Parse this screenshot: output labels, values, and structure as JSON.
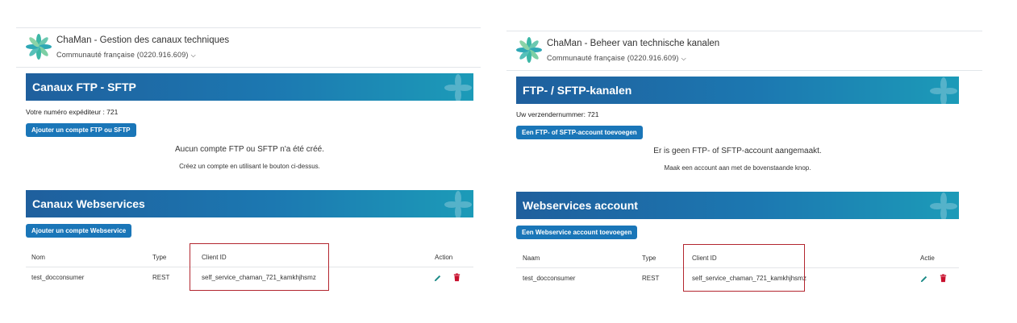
{
  "colors": {
    "banner_start": "#1f5f9d",
    "banner_end": "#1c9bb8",
    "button": "#1a76b8",
    "edit_icon": "#1a8a86",
    "delete_icon": "#c8102e",
    "highlight_box": "#b3262f"
  },
  "fr": {
    "header": {
      "app_title": "ChaMan - Gestion des canaux techniques",
      "org": "Communauté française (0220.916.609)"
    },
    "ftp": {
      "title": "Canaux FTP - SFTP",
      "sender": "Votre numéro expéditeur : 721",
      "add_button": "Ajouter un compte FTP ou SFTP",
      "empty_message": "Aucun compte FTP ou SFTP n'a été créé.",
      "empty_hint": "Créez un compte en utilisant le bouton ci-dessus."
    },
    "ws": {
      "title": "Canaux Webservices",
      "add_button": "Ajouter un compte Webservice",
      "columns": {
        "name": "Nom",
        "type": "Type",
        "client_id": "Client ID",
        "action": "Action"
      },
      "row": {
        "name": "test_docconsumer",
        "type": "REST",
        "client_id": "self_service_chaman_721_kamkhjhsmz"
      }
    }
  },
  "nl": {
    "header": {
      "app_title": "ChaMan - Beheer van technische kanalen",
      "org": "Communauté française (0220.916.609)"
    },
    "ftp": {
      "title": "FTP- / SFTP-kanalen",
      "sender": "Uw verzendernummer: 721",
      "add_button": "Een FTP- of SFTP-account toevoegen",
      "empty_message": "Er is geen FTP- of SFTP-account aangemaakt.",
      "empty_hint": "Maak een account aan met de bovenstaande knop."
    },
    "ws": {
      "title": "Webservices account",
      "add_button": "Een Webservice account toevoegen",
      "columns": {
        "name": "Naam",
        "type": "Type",
        "client_id": "Client ID",
        "action": "Actie"
      },
      "row": {
        "name": "test_docconsumer",
        "type": "REST",
        "client_id": "self_service_chaman_721_kamkhjhsmz"
      }
    }
  }
}
